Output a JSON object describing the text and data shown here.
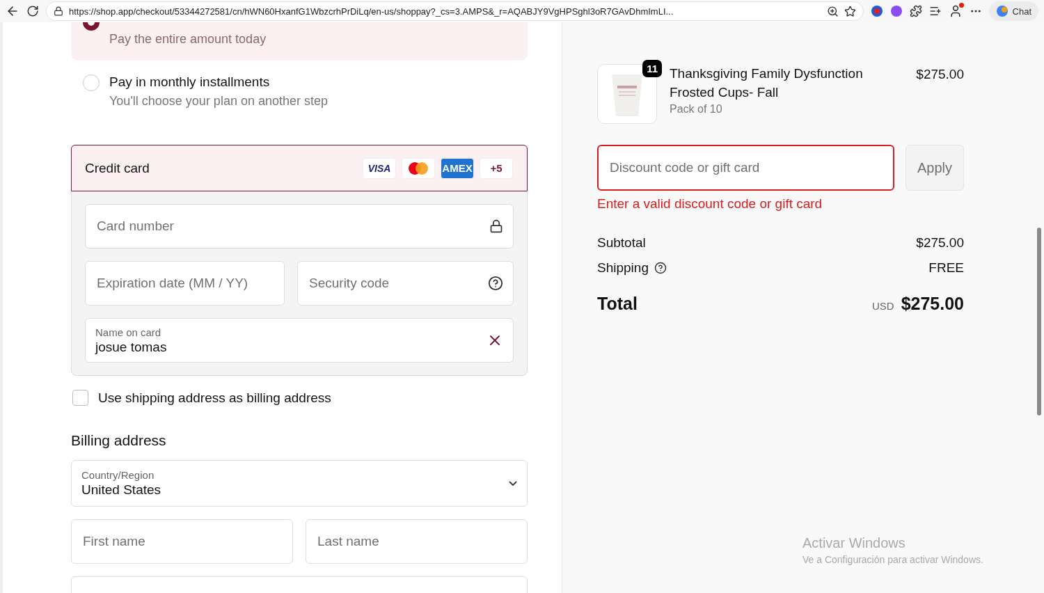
{
  "browser": {
    "url": "https://shop.app/checkout/53344272581/cn/hWN60HxanfG1WbzcrhPrDiLq/en-us/shoppay?_cs=3.AMPS&_r=AQABJY9VgHPSghl3oR7GAvDhmImLI...",
    "chat_label": "Chat",
    "profile_notification": true
  },
  "payment_options": [
    {
      "subtitle": "Pay the entire amount today",
      "selected": true
    },
    {
      "title": "Pay in monthly installments",
      "subtitle": "You'll choose your plan on another step",
      "selected": false
    }
  ],
  "credit_card": {
    "title": "Credit card",
    "brands": [
      {
        "kind": "visa",
        "label": "VISA"
      },
      {
        "kind": "mastercard"
      },
      {
        "kind": "amex",
        "label": "AMEX"
      },
      {
        "kind": "more",
        "label": "+5"
      }
    ],
    "fields": [
      {
        "kind": "card",
        "placeholder": "Card number"
      },
      {
        "kind": "expiry",
        "placeholder": "Expiration date (MM / YY)"
      },
      {
        "kind": "cvv",
        "placeholder": "Security code"
      },
      {
        "kind": "name",
        "label": "Name on card",
        "value": "josue tomas"
      }
    ]
  },
  "billing_same": {
    "label": "Use shipping address as billing address",
    "checked": false
  },
  "billing": {
    "title": "Billing address",
    "country_label": "Country/Region",
    "country": "United States",
    "first_name": {
      "placeholder": "First name"
    },
    "last_name": {
      "placeholder": "Last name"
    }
  },
  "summary": {
    "item": {
      "quantity": "11",
      "name": "Thanksgiving Family Dysfunction Frosted Cups- Fall",
      "variant": "Pack of 10",
      "price": "$275.00"
    },
    "discount": {
      "placeholder": "Discount code or gift card",
      "error": "Enter a valid discount code or gift card",
      "button": "Apply"
    },
    "subtotal_label": "Subtotal",
    "subtotal": "$275.00",
    "shipping_label": "Shipping",
    "shipping": "FREE",
    "total_label": "Total",
    "currency": "USD",
    "total": "$275.00"
  },
  "os_notice": {
    "title": "Activar Windows",
    "text": "Ve a Configuración para activar Windows."
  }
}
